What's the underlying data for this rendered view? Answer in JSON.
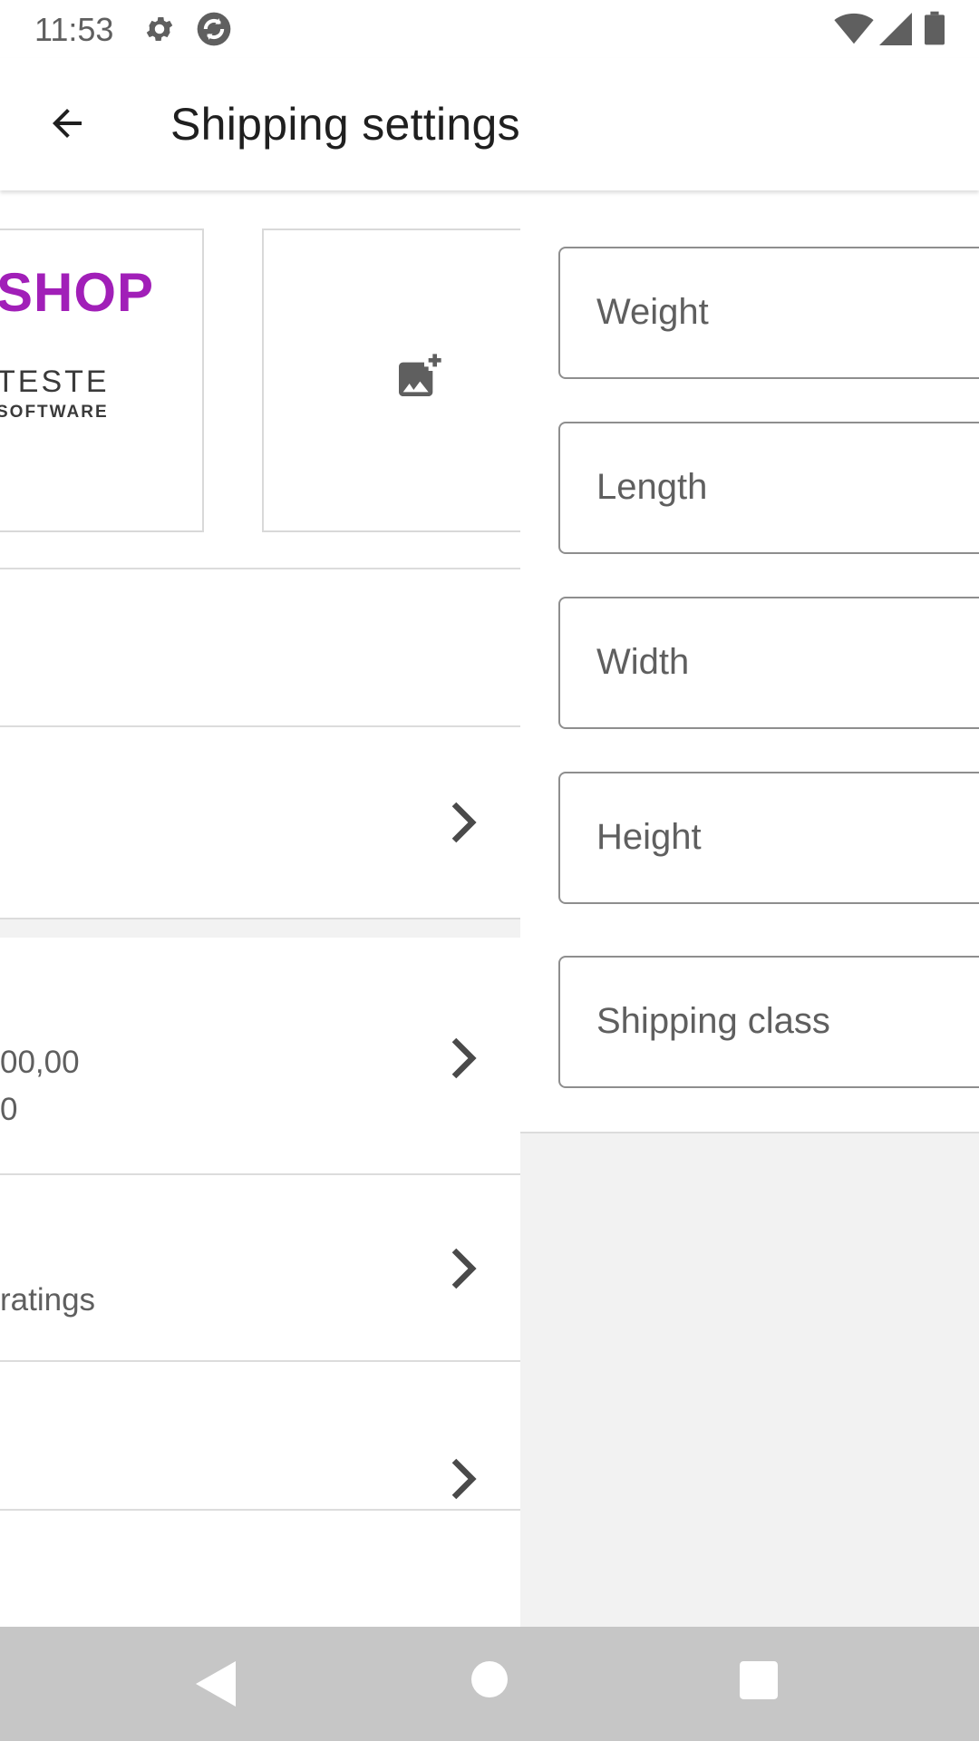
{
  "status_bar": {
    "time": "11:53",
    "icons": [
      "gear-icon",
      "sync-icon",
      "wifi-icon",
      "cell-signal-icon",
      "battery-icon"
    ]
  },
  "app_bar": {
    "title": "Shipping settings",
    "back_icon": "arrow-back-icon"
  },
  "product_image": {
    "logo_word": "SHOP",
    "logo_line1": "TESTE",
    "logo_line2": "SOFTWARE"
  },
  "underlying_rows": {
    "price_line1": "00,00",
    "price_line2": "0",
    "reviews_text": "ratings"
  },
  "shipping_form": {
    "fields": [
      {
        "label": "Weight"
      },
      {
        "label": "Length"
      },
      {
        "label": "Width"
      },
      {
        "label": "Height"
      },
      {
        "label": "Shipping class"
      }
    ]
  },
  "nav_bar": {
    "buttons": [
      "nav-back-icon",
      "nav-home-icon",
      "nav-recents-icon"
    ]
  },
  "colors": {
    "accent_logo": "#a11fb8",
    "field_border": "#8e8e8e",
    "nav_background": "#c6c6c6",
    "sheet_background": "#f2f2f2"
  }
}
